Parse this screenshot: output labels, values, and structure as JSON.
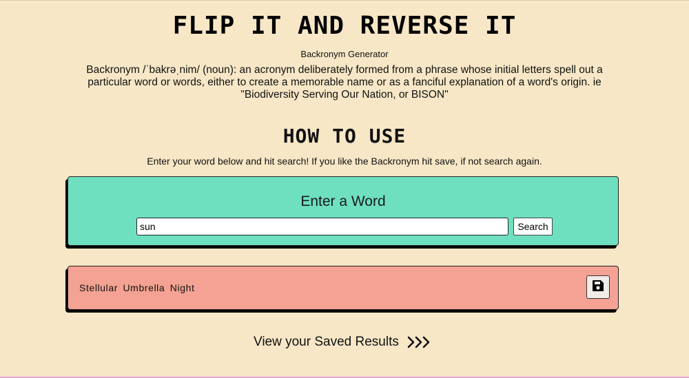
{
  "header": {
    "title": "FLIP IT AND REVERSE IT",
    "subtitle": "Backronym Generator",
    "definition": "Backronym /ˈbakrəˌnim/ (noun): an acronym deliberately formed from a phrase whose initial letters spell out a particular word or words, either to create a memorable name or as a fanciful explanation of a word's origin. ie \"Biodiversity Serving Our Nation, or BISON\""
  },
  "howto": {
    "heading": "HOW TO USE",
    "instructions": "Enter your word below and hit search! If you like the Backronym hit save, if not search again."
  },
  "search": {
    "label": "Enter a Word",
    "value": "sun",
    "button_label": "Search"
  },
  "result": {
    "text": "Stellular Umbrella Night",
    "save_icon": "floppy-disk-icon"
  },
  "footer": {
    "link_label": "View your Saved Results",
    "link_icon": "triple-chevron-right-icon"
  },
  "colors": {
    "background": "#f7e7c6",
    "search_card": "#6ee0c0",
    "result_card": "#f4a293"
  }
}
